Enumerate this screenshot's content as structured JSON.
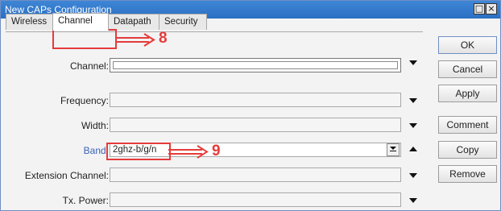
{
  "window": {
    "title": "New CAPs Configuration",
    "minimize_glyph": "□",
    "close_glyph": "×"
  },
  "tabs": [
    {
      "label": "Wireless",
      "active": false
    },
    {
      "label": "Channel",
      "active": true
    },
    {
      "label": "Datapath",
      "active": false
    },
    {
      "label": "Security",
      "active": false
    }
  ],
  "fields": {
    "channel": {
      "label": "Channel:",
      "value": ""
    },
    "frequency": {
      "label": "Frequency:",
      "value": ""
    },
    "width": {
      "label": "Width:",
      "value": ""
    },
    "band": {
      "label": "Band:",
      "value": "2ghz-b/g/n"
    },
    "extension_channel": {
      "label": "Extension Channel:",
      "value": ""
    },
    "tx_power": {
      "label": "Tx. Power:",
      "value": ""
    }
  },
  "buttons": {
    "ok": "OK",
    "cancel": "Cancel",
    "apply": "Apply",
    "comment": "Comment",
    "copy": "Copy",
    "remove": "Remove"
  },
  "annotations": {
    "step_8": "8",
    "step_9": "9",
    "color": "#e53b3b"
  },
  "icons": {
    "dropdown": "chevron-down-icon",
    "spin": "spin-down-icon",
    "remove_value": "up-arrow-icon"
  }
}
